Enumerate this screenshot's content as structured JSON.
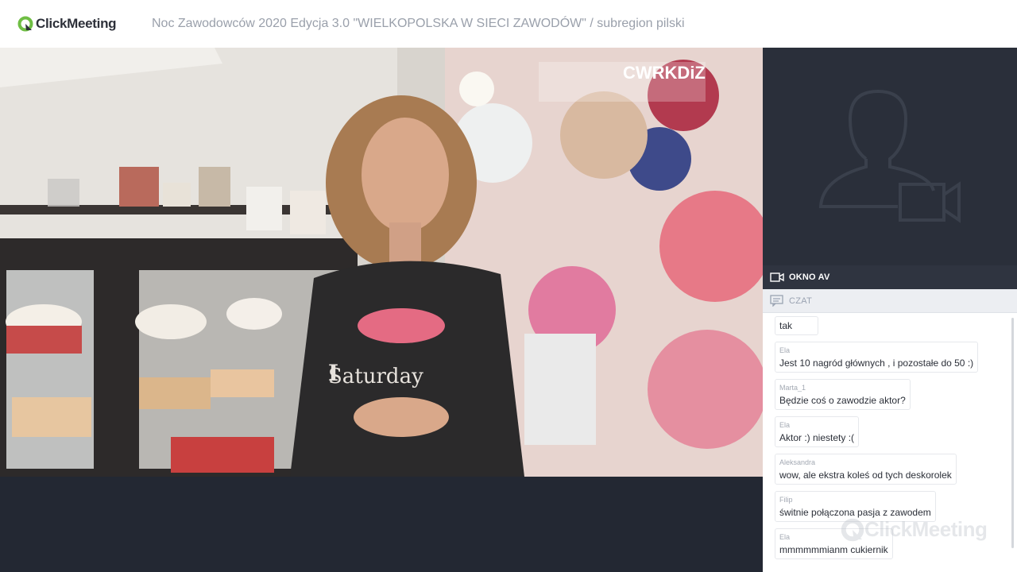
{
  "app": {
    "brand": "ClickMeeting",
    "event_title": "Noc Zawodowców 2020 Edycja 3.0 \"WIELKOPOLSKA W SIECI ZAWODÓW\" / subregion pilski"
  },
  "video": {
    "overlay_logo_text": "CWRKDiZ",
    "shirt_text_top": "I",
    "shirt_text_bottom": "Saturday"
  },
  "sidebar": {
    "av_label": "OKNO AV",
    "chat_label": "CZAT"
  },
  "chat": {
    "messages": [
      {
        "author": "",
        "text": "tak"
      },
      {
        "author": "Ela",
        "text": "Jest 10 nagród głównych , i pozostałe do 50 :)"
      },
      {
        "author": "Marta_1",
        "text": "Będzie coś o zawodzie aktor?"
      },
      {
        "author": "Ela",
        "text": "Aktor :) niestety :("
      },
      {
        "author": "Aleksandra",
        "text": "wow, ale ekstra koleś od tych deskorolek"
      },
      {
        "author": "Filip",
        "text": "świtnie połączona pasja z zawodem"
      },
      {
        "author": "Ela",
        "text": "mmmmmmianm cukiernik"
      }
    ],
    "watermark": "ClickMeeting"
  },
  "colors": {
    "accent_green": "#6fbe44",
    "dark_bg": "#232833",
    "panel_bg": "#2a2f3a"
  }
}
